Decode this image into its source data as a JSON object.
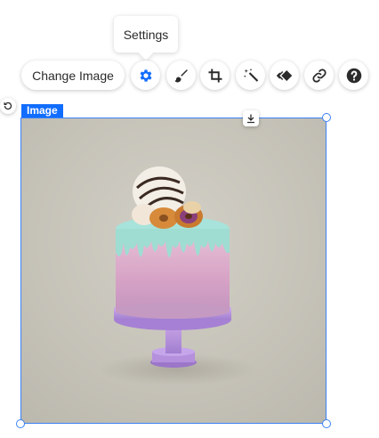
{
  "tooltip": {
    "text": "Settings"
  },
  "toolbar": {
    "change_image_label": "Change Image",
    "buttons": [
      {
        "icon": "gear-icon",
        "name": "settings-button"
      },
      {
        "icon": "brush-icon",
        "name": "design-button"
      },
      {
        "icon": "crop-icon",
        "name": "crop-button"
      },
      {
        "icon": "magic-wand-icon",
        "name": "enhance-button"
      },
      {
        "icon": "animation-icon",
        "name": "animation-button"
      },
      {
        "icon": "link-icon",
        "name": "link-button"
      },
      {
        "icon": "help-icon",
        "name": "help-button"
      }
    ]
  },
  "selection": {
    "tag_label": "Image"
  },
  "colors": {
    "accent": "#116dff",
    "frame": "#3b82f6",
    "backdrop": "#c8c5bb",
    "frosting": "#9fdcd2",
    "cake": "#d9a6c4",
    "stand": "#b58bd6"
  }
}
